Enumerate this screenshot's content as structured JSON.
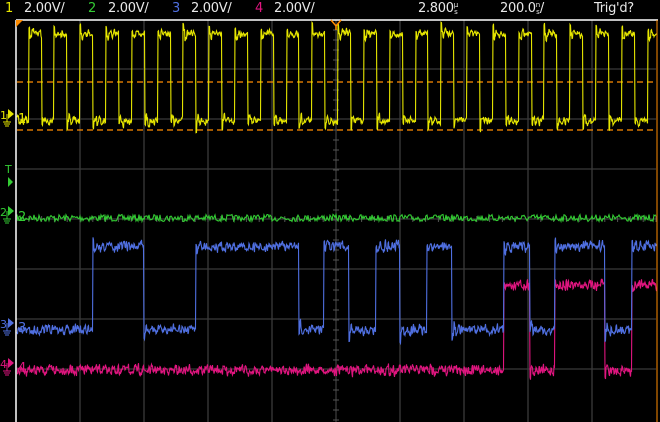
{
  "channels": [
    {
      "id": "1",
      "scale": "2.00V/",
      "color": "#e6e600",
      "label": "1"
    },
    {
      "id": "2",
      "scale": "2.00V/",
      "color": "#33cc33",
      "label": "2"
    },
    {
      "id": "3",
      "scale": "2.00V/",
      "color": "#4f6fe0",
      "label": "3"
    },
    {
      "id": "4",
      "scale": "2.00V/",
      "color": "#e0157f",
      "label": "4"
    }
  ],
  "timebase": {
    "delay_value": "2.800",
    "delay_prefix": "µ",
    "delay_unit": "s",
    "scale_value": "200.0",
    "scale_prefix": "n",
    "scale_unit": "s",
    "scale_suffix": "/"
  },
  "trigger": {
    "status": "Trig'd?",
    "marker_label": "T",
    "color": "#33cc33"
  },
  "colors": {
    "grid": "#3a3a3a",
    "border": "#ffffff",
    "cursor": "#ff8c00"
  },
  "waveforms": {
    "ch1": {
      "type": "clock",
      "high_v": 3.5,
      "low_v": 0,
      "period_div": 0.403,
      "first_rise_div": 0.19,
      "duty": 0.5
    },
    "ch2": {
      "type": "flat",
      "level_v": 0
    },
    "ch3": {
      "type": "edges",
      "high_v": 3.35,
      "low_v": 0,
      "initial": "low",
      "edges_div": [
        1.2,
        2.0,
        2.8,
        4.41,
        4.8,
        5.2,
        5.61,
        6.0,
        6.41,
        6.81,
        7.61,
        8.02,
        8.41,
        9.2,
        9.61
      ]
    },
    "ch4": {
      "type": "edges",
      "high_v": 3.4,
      "low_v": 0,
      "initial": "low",
      "edges_div": [
        7.61,
        8.02,
        8.41,
        9.2,
        9.61
      ]
    }
  }
}
